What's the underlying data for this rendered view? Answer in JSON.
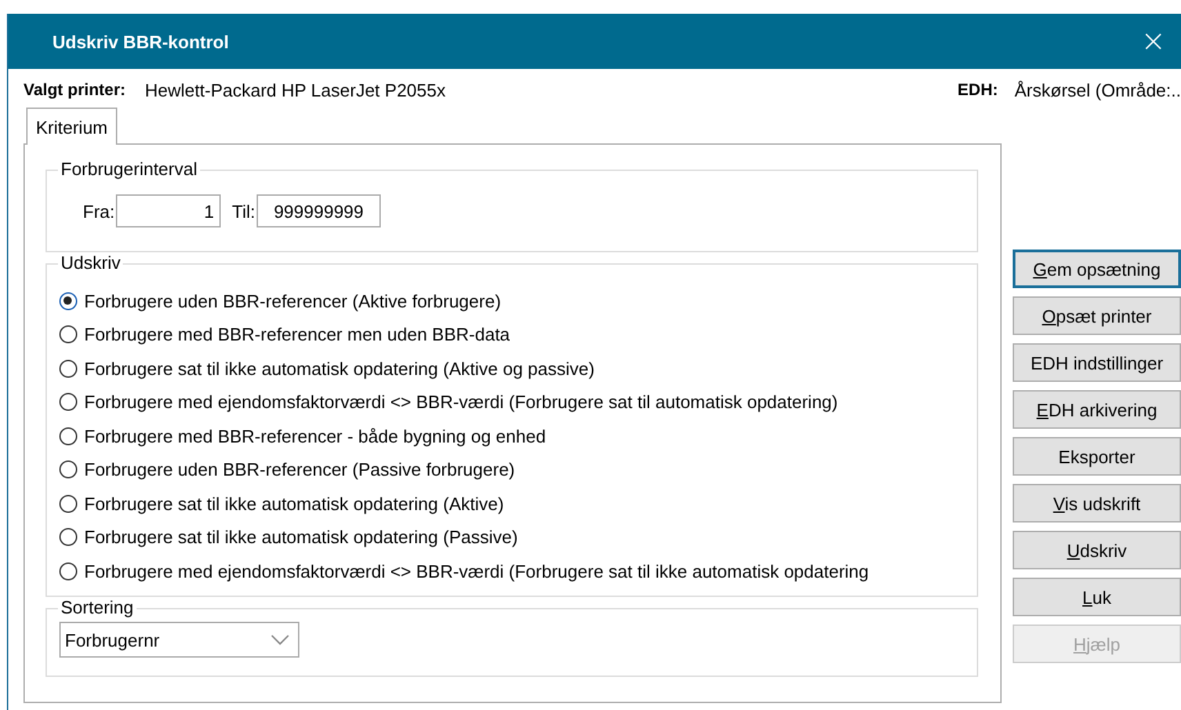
{
  "window": {
    "title": "Udskriv BBR-kontrol",
    "close": "×"
  },
  "printer": {
    "label": "Valgt printer:",
    "value": "Hewlett-Packard HP LaserJet P2055x"
  },
  "edh": {
    "label": "EDH:",
    "value": "Årskørsel (Område:.."
  },
  "tabs": [
    {
      "label": "Kriterium",
      "selected": true
    }
  ],
  "interval": {
    "title": "Forbrugerinterval",
    "from_label": "Fra:",
    "from_value": "1",
    "to_label": "Til:",
    "to_value": "999999999"
  },
  "print_group": {
    "title": "Udskriv",
    "options": [
      {
        "label": "Forbrugere uden BBR-referencer (Aktive forbrugere)",
        "selected": true
      },
      {
        "label": "Forbrugere med BBR-referencer men uden BBR-data",
        "selected": false
      },
      {
        "label": "Forbrugere sat til ikke automatisk opdatering (Aktive og passive)",
        "selected": false
      },
      {
        "label": "Forbrugere med ejendomsfaktorværdi <> BBR-værdi (Forbrugere sat til automatisk opdatering)",
        "selected": false
      },
      {
        "label": "Forbrugere med BBR-referencer - både bygning og enhed",
        "selected": false
      },
      {
        "label": "Forbrugere uden BBR-referencer (Passive forbrugere)",
        "selected": false
      },
      {
        "label": "Forbrugere sat til ikke automatisk opdatering (Aktive)",
        "selected": false
      },
      {
        "label": "Forbrugere sat til ikke automatisk opdatering (Passive)",
        "selected": false
      },
      {
        "label": "Forbrugere med ejendomsfaktorværdi <> BBR-værdi (Forbrugere sat til ikke automatisk opdatering",
        "selected": false
      }
    ]
  },
  "sorting": {
    "title": "Sortering",
    "value": "Forbrugernr"
  },
  "buttons": [
    {
      "key": "G",
      "rest": "em opsætning",
      "focused": true,
      "disabled": false
    },
    {
      "key": "O",
      "rest": "psæt printer",
      "focused": false,
      "disabled": false
    },
    {
      "label": "EDH indstillinger",
      "focused": false,
      "disabled": false
    },
    {
      "key": "E",
      "rest": "DH arkivering",
      "focused": false,
      "disabled": false
    },
    {
      "label": "Eksporter",
      "focused": false,
      "disabled": false
    },
    {
      "key": "V",
      "rest": "is udskrift",
      "focused": false,
      "disabled": false
    },
    {
      "key": "U",
      "rest": "dskriv",
      "focused": false,
      "disabled": false
    },
    {
      "key": "L",
      "rest": "uk",
      "focused": false,
      "disabled": false
    },
    {
      "key": "H",
      "rest": "jælp",
      "focused": false,
      "disabled": true
    }
  ]
}
